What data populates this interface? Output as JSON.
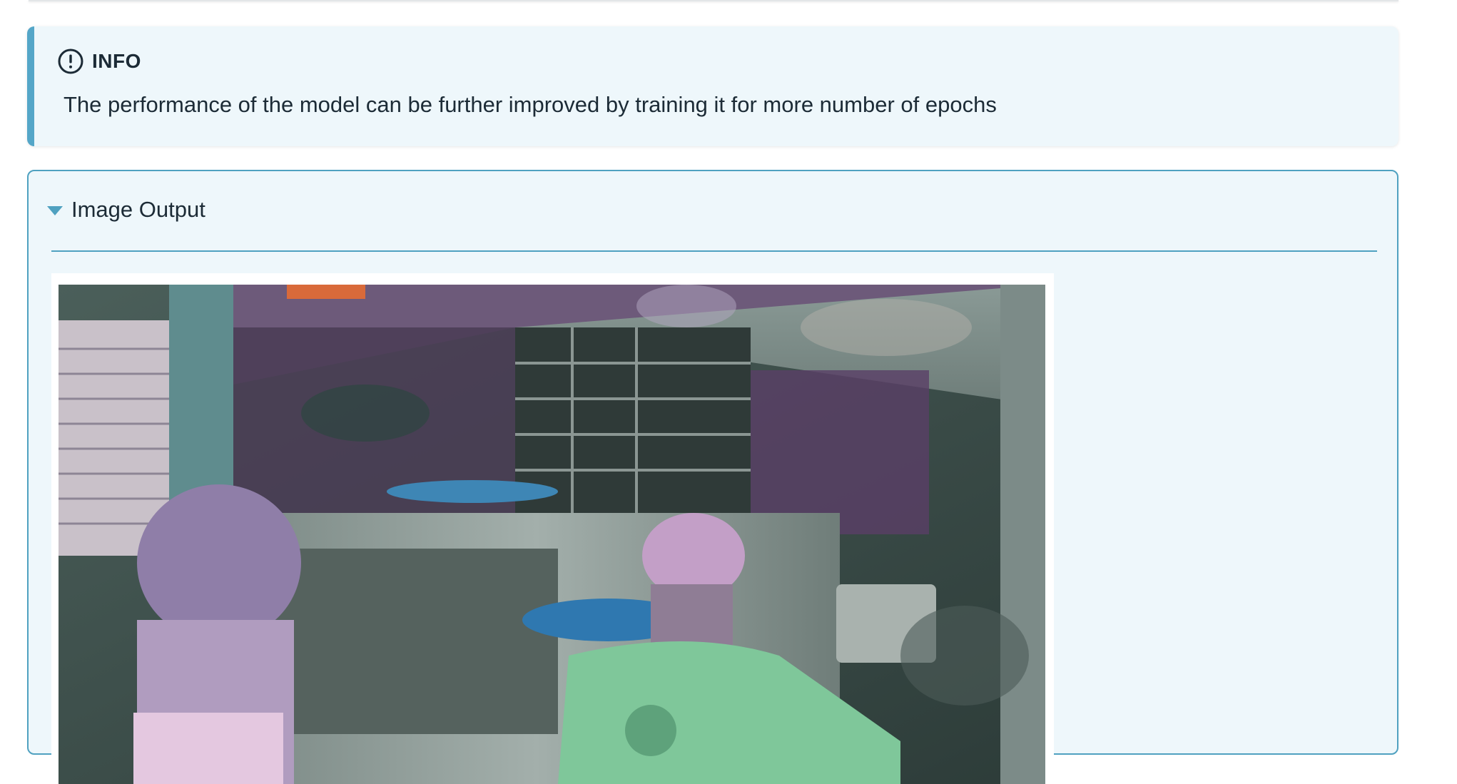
{
  "info_admonition": {
    "title": "INFO",
    "icon": "exclamation-circle-icon",
    "body": "The performance of the model can be further improved by training it for more number of epochs"
  },
  "image_output": {
    "summary_label": "Image Output",
    "expanded": true,
    "image_alt": "Segmentation overlay on a pizza kitchen photo"
  },
  "colors": {
    "accent": "#54a6c8",
    "panel_background": "#eef7fb",
    "text": "#1c2b36"
  }
}
